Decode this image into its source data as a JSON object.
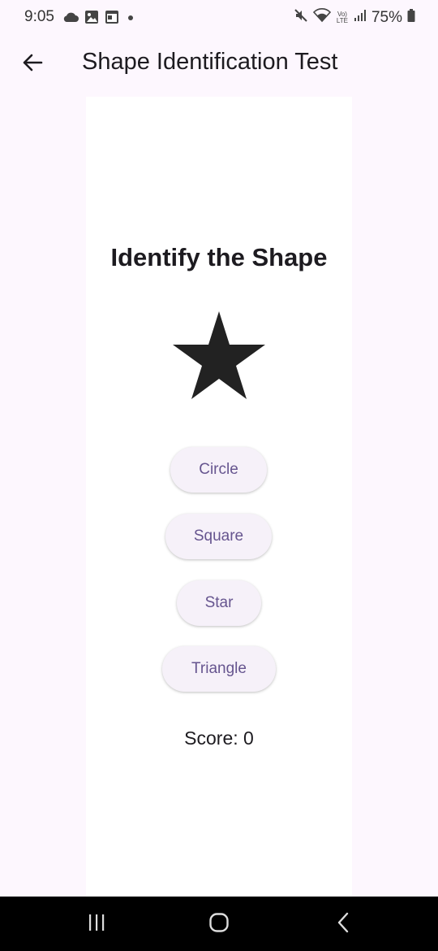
{
  "status_bar": {
    "time": "9:05",
    "battery": "75%",
    "network_label": "Vo) LTE",
    "icons": [
      "cloud-icon",
      "gallery-icon",
      "window-icon",
      "dot-icon",
      "mute-icon",
      "wifi-icon",
      "signal-icon",
      "battery-icon"
    ]
  },
  "app_bar": {
    "title": "Shape Identification Test",
    "back_icon": "arrow-left-icon"
  },
  "quiz": {
    "heading": "Identify the Shape",
    "shape_icon": "star-icon",
    "shape_color": "#222222",
    "options": [
      "Circle",
      "Square",
      "Star",
      "Triangle"
    ],
    "score_text": "Score: 0"
  },
  "nav_bar": {
    "icons": [
      "recent-apps-icon",
      "home-icon",
      "back-nav-icon"
    ]
  },
  "colors": {
    "background": "#fdf7fe",
    "panel": "#ffffff",
    "button_fill": "#f6f1f9",
    "button_text": "#66558f"
  }
}
